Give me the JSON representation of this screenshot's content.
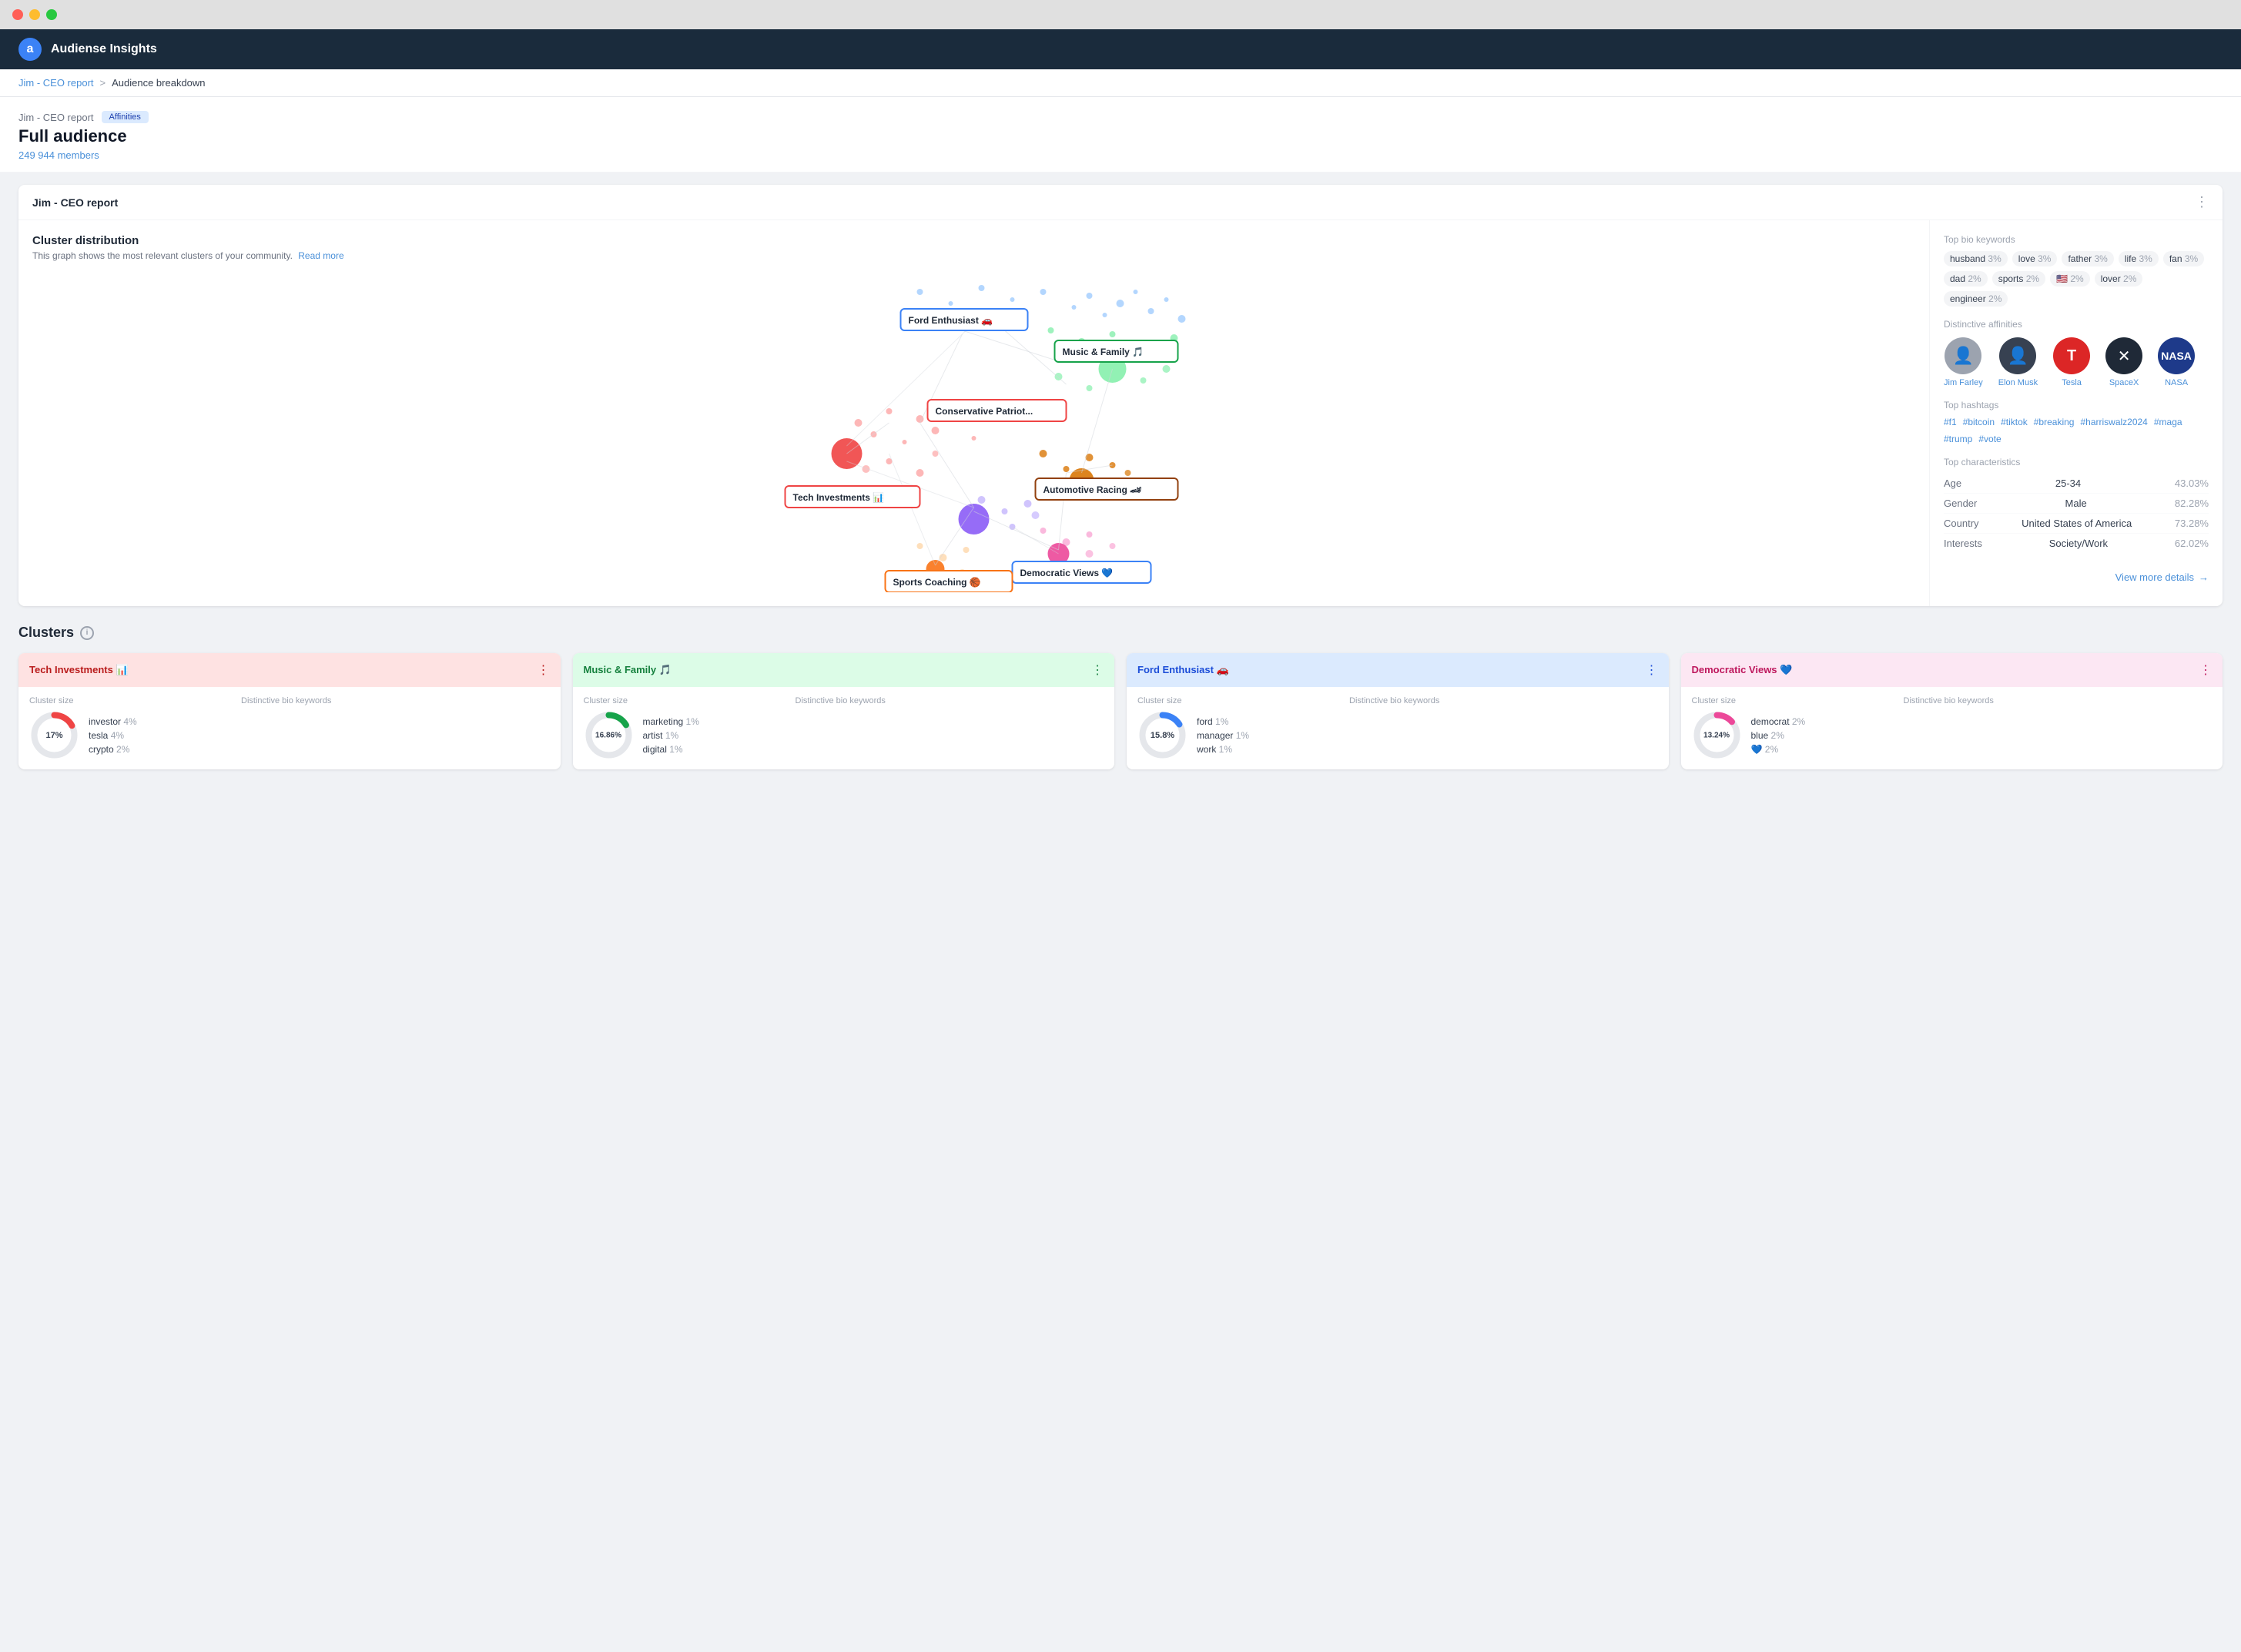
{
  "window": {
    "dots": [
      "red",
      "yellow",
      "green"
    ]
  },
  "navbar": {
    "logo_letter": "a",
    "app_name": "Audiense Insights"
  },
  "breadcrumb": {
    "link": "Jim - CEO report",
    "separator": ">",
    "current": "Audience breakdown"
  },
  "page_header": {
    "report_name": "Jim - CEO report",
    "badge": "Affinities",
    "title": "Full audience",
    "member_count": "249 944 members"
  },
  "main_card": {
    "title": "Jim - CEO report",
    "menu_icon": "⋮"
  },
  "cluster_distribution": {
    "title": "Cluster distribution",
    "subtitle": "This graph shows the most relevant clusters of your community.",
    "read_more": "Read more"
  },
  "cluster_labels": [
    {
      "id": "ford",
      "label": "Ford Enthusiast 🚗",
      "color": "#3b82f6",
      "left": "215",
      "top": "60"
    },
    {
      "id": "music",
      "label": "Music & Family 🎵",
      "color": "#16a34a",
      "left": "390",
      "top": "100"
    },
    {
      "id": "conservative",
      "label": "Conservative Patriot...",
      "color": "#ef4444",
      "left": "240",
      "top": "200"
    },
    {
      "id": "tech",
      "label": "Tech Investments 📊",
      "color": "#ef4444",
      "left": "90",
      "top": "290"
    },
    {
      "id": "automotive",
      "label": "Automotive Racing 🏎",
      "color": "#92400e",
      "left": "390",
      "top": "280"
    },
    {
      "id": "democratic",
      "label": "Democratic Views 💙",
      "color": "#3b82f6",
      "left": "360",
      "top": "380"
    },
    {
      "id": "sports",
      "label": "Sports Coaching 🏀",
      "color": "#f97316",
      "left": "200",
      "top": "400"
    }
  ],
  "bio_keywords": {
    "section_title": "Top bio keywords",
    "items": [
      {
        "word": "husband",
        "pct": "3%"
      },
      {
        "word": "love",
        "pct": "3%"
      },
      {
        "word": "father",
        "pct": "3%"
      },
      {
        "word": "life",
        "pct": "3%"
      },
      {
        "word": "fan",
        "pct": "3%"
      },
      {
        "word": "dad",
        "pct": "2%"
      },
      {
        "word": "sports",
        "pct": "2%"
      },
      {
        "word": "🇺🇸",
        "pct": "2%"
      },
      {
        "word": "lover",
        "pct": "2%"
      },
      {
        "word": "engineer",
        "pct": "2%"
      }
    ]
  },
  "distinctive_affinities": {
    "section_title": "Distinctive affinities",
    "items": [
      {
        "name": "Jim Farley",
        "icon": "👤",
        "bg": "#d1d5db"
      },
      {
        "name": "Elon Musk",
        "icon": "👤",
        "bg": "#374151"
      },
      {
        "name": "Tesla",
        "icon": "T",
        "bg": "#dc2626"
      },
      {
        "name": "SpaceX",
        "icon": "✕",
        "bg": "#1f2937"
      },
      {
        "name": "NASA",
        "icon": "N",
        "bg": "#1e3a8a"
      }
    ]
  },
  "top_hashtags": {
    "section_title": "Top hashtags",
    "items": [
      "#f1",
      "#bitcoin",
      "#tiktok",
      "#breaking",
      "#harriswalz2024",
      "#maga",
      "#trump",
      "#vote"
    ]
  },
  "top_characteristics": {
    "section_title": "Top characteristics",
    "rows": [
      {
        "label": "Age",
        "value": "25-34",
        "pct": "43.03%"
      },
      {
        "label": "Gender",
        "value": "Male",
        "pct": "82.28%"
      },
      {
        "label": "Country",
        "value": "United States of America",
        "pct": "73.28%"
      },
      {
        "label": "Interests",
        "value": "Society/Work",
        "pct": "62.02%"
      }
    ]
  },
  "view_more": "View more details",
  "clusters_section": {
    "title": "Clusters",
    "cards": [
      {
        "id": "tech",
        "title": "Tech Investments 📊",
        "theme": "red",
        "pct": "17%",
        "donut_color": "#ef4444",
        "keywords": [
          {
            "word": "investor",
            "pct": "4%"
          },
          {
            "word": "tesla",
            "pct": "4%"
          },
          {
            "word": "crypto",
            "pct": "2%"
          }
        ]
      },
      {
        "id": "music",
        "title": "Music & Family 🎵",
        "theme": "green",
        "pct": "16.86%",
        "donut_color": "#16a34a",
        "keywords": [
          {
            "word": "marketing",
            "pct": "1%"
          },
          {
            "word": "artist",
            "pct": "1%"
          },
          {
            "word": "digital",
            "pct": "1%"
          }
        ]
      },
      {
        "id": "ford",
        "title": "Ford Enthusiast 🚗",
        "theme": "blue",
        "pct": "15.8%",
        "donut_color": "#3b82f6",
        "keywords": [
          {
            "word": "ford",
            "pct": "1%"
          },
          {
            "word": "manager",
            "pct": "1%"
          },
          {
            "word": "work",
            "pct": "1%"
          }
        ]
      },
      {
        "id": "democratic",
        "title": "Democratic Views 💙",
        "theme": "pink",
        "pct": "13.24%",
        "donut_color": "#ec4899",
        "keywords": [
          {
            "word": "democrat",
            "pct": "2%"
          },
          {
            "word": "blue",
            "pct": "2%"
          },
          {
            "word": "💙",
            "pct": "2%"
          }
        ]
      }
    ]
  },
  "dots_colors": {
    "red": "#ef4444",
    "blue": "#3b82f6",
    "green": "#16a34a",
    "purple": "#8b5cf6",
    "pink": "#ec4899",
    "orange": "#f97316",
    "brown": "#92400e"
  }
}
